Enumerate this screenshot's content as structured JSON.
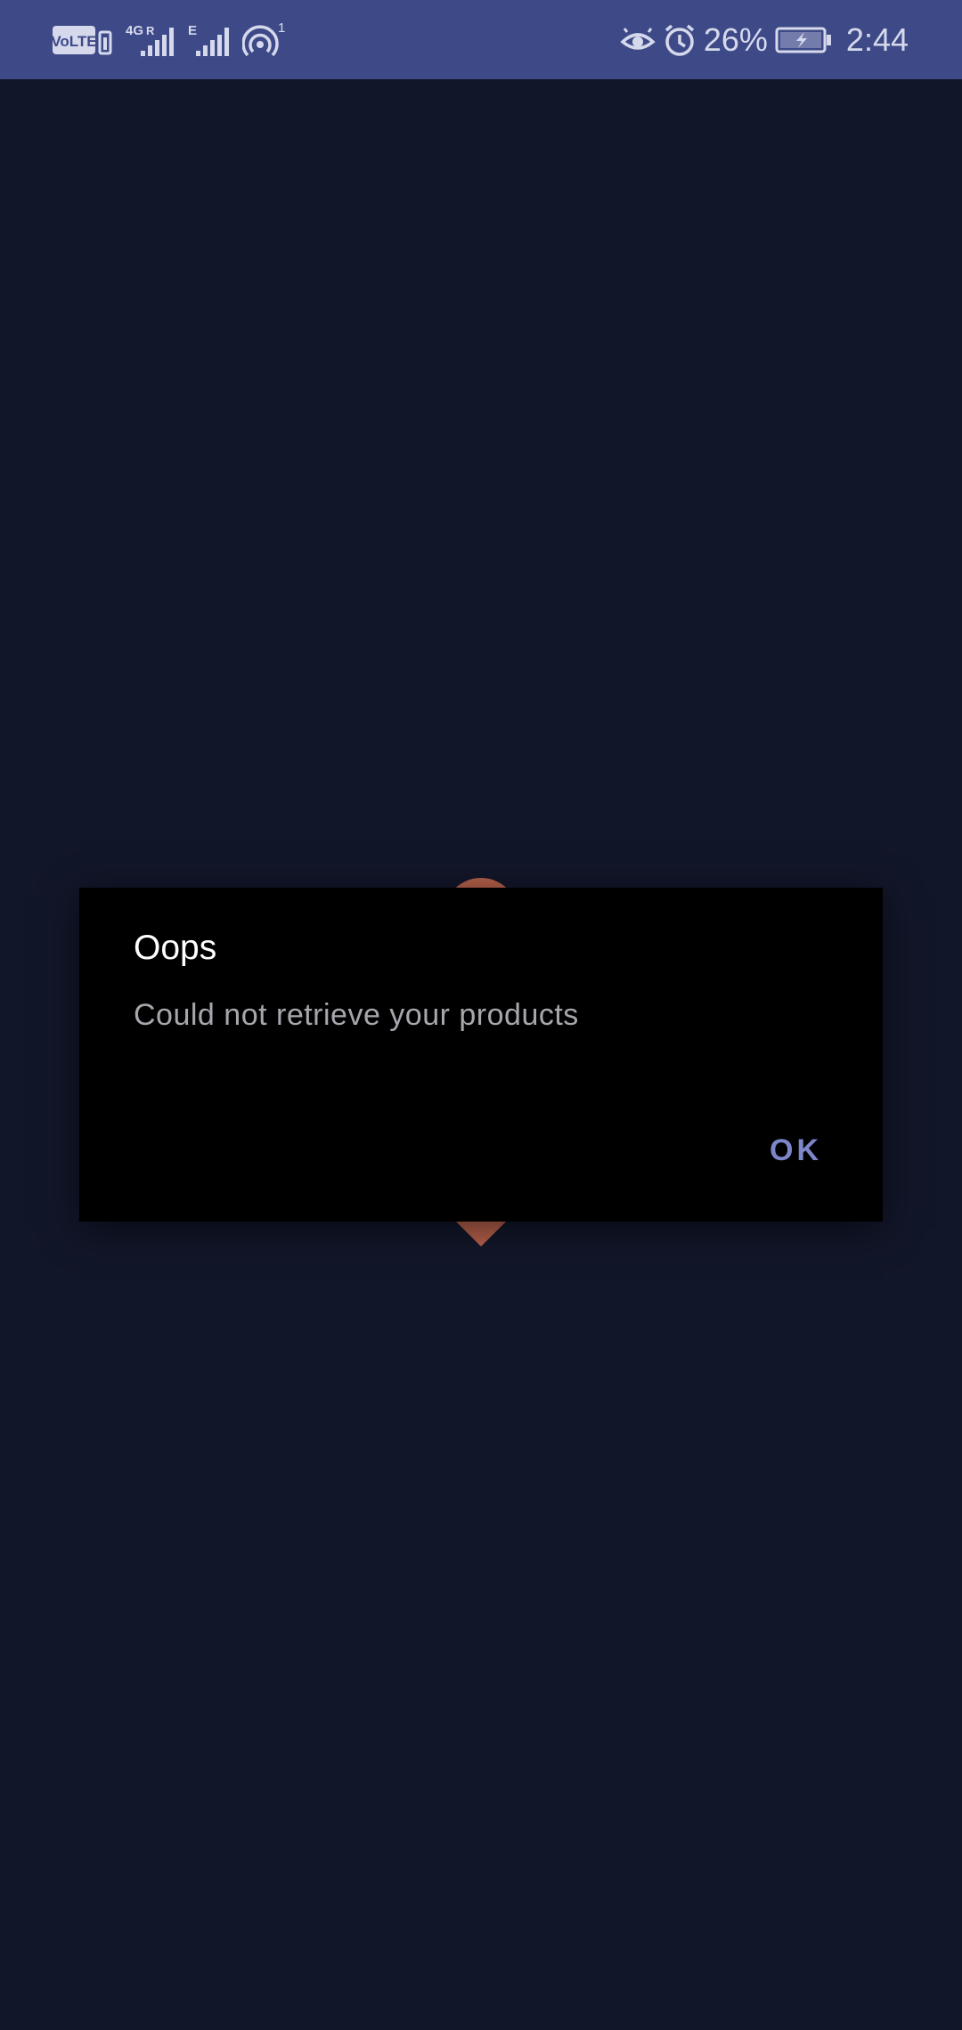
{
  "status_bar": {
    "left_icons": [
      "volte-icon",
      "signal-4g-icon",
      "signal-e-icon",
      "hotspot-icon"
    ],
    "volte_label": "VoLTE",
    "network_4g_label": "4G",
    "network_e_label": "E",
    "hotspot_count": "1",
    "right_icons": [
      "eye-comfort-icon",
      "alarm-icon",
      "battery-charging-icon"
    ],
    "battery_percent": "26%",
    "time": "2:44",
    "colors": {
      "background": "#3e4a87",
      "foreground": "#d6d9ec"
    }
  },
  "screen": {
    "background_color": "#121629",
    "loader_color": "#b5604a"
  },
  "dialog": {
    "title": "Oops",
    "message": "Could not retrieve your products",
    "ok_label": "OK",
    "colors": {
      "background": "#000000",
      "title": "#ffffff",
      "message": "#a6a6ad",
      "button": "#7d86c9"
    }
  }
}
